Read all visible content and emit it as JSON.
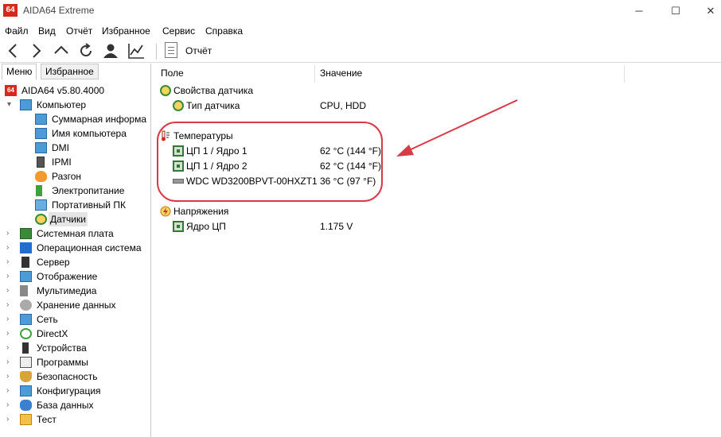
{
  "window": {
    "logo": "64",
    "title": "AIDA64 Extreme",
    "controls": {
      "minimize": "─",
      "maximize": "☐",
      "close": "✕"
    }
  },
  "menu": [
    "Файл",
    "Вид",
    "Отчёт",
    "Избранное",
    "Сервис",
    "Справка"
  ],
  "toolbar": {
    "icons": [
      "back-icon",
      "forward-icon",
      "up-icon",
      "refresh-icon",
      "user-icon",
      "chart-icon"
    ],
    "report_label": "Отчёт"
  },
  "tabs": {
    "menu": "Меню",
    "favorites": "Избранное"
  },
  "tree": {
    "root": "AIDA64 v5.80.4000",
    "computer": "Компьютер",
    "computer_children": [
      "Суммарная информа",
      "Имя компьютера",
      "DMI",
      "IPMI",
      "Разгон",
      "Электропитание",
      "Портативный ПК",
      "Датчики"
    ],
    "selected": "Датчики",
    "sections": [
      "Системная плата",
      "Операционная система",
      "Сервер",
      "Отображение",
      "Мультимедиа",
      "Хранение данных",
      "Сеть",
      "DirectX",
      "Устройства",
      "Программы",
      "Безопасность",
      "Конфигурация",
      "База данных",
      "Тест"
    ]
  },
  "columns": {
    "field": "Поле",
    "value": "Значение"
  },
  "rows": {
    "sensor_props": "Свойства датчика",
    "sensor_type_label": "Тип датчика",
    "sensor_type_value": "CPU, HDD",
    "temps": "Температуры",
    "cpu1_label": "ЦП 1 / Ядро 1",
    "cpu1_value": "62 °C  (144 °F)",
    "cpu2_label": "ЦП 1 / Ядро 2",
    "cpu2_value": "62 °C  (144 °F)",
    "hdd_label": "WDC WD3200BPVT-00HXZT1",
    "hdd_value": "36 °C  (97 °F)",
    "voltages": "Напряжения",
    "vcore_label": "Ядро ЦП",
    "vcore_value": "1.175 V"
  },
  "colors": {
    "accent": "#d42a1e",
    "annotation": "#d83a48",
    "selection": "#e5e5e5"
  }
}
